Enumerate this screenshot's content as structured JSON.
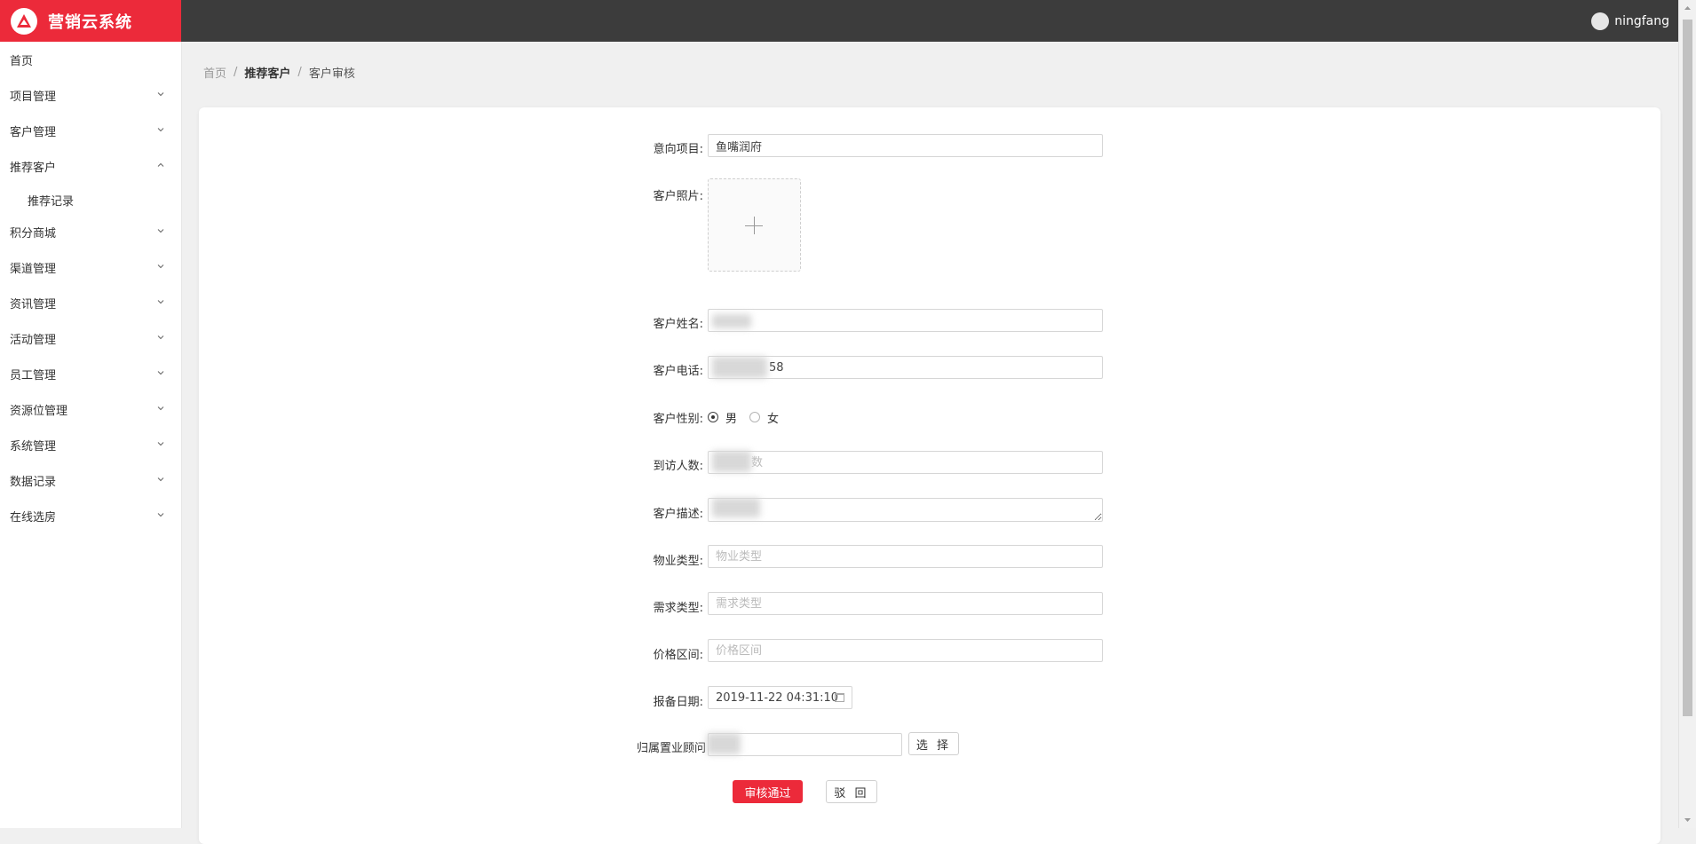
{
  "app": {
    "title": "营销云系统",
    "user": "ningfang"
  },
  "sidebar": {
    "items": [
      {
        "label": "首页",
        "has_arrow": false
      },
      {
        "label": "项目管理",
        "has_arrow": true
      },
      {
        "label": "客户管理",
        "has_arrow": true
      },
      {
        "label": "推荐客户",
        "has_arrow": true,
        "expanded": true,
        "children": [
          {
            "label": "推荐记录"
          }
        ]
      },
      {
        "label": "积分商城",
        "has_arrow": true
      },
      {
        "label": "渠道管理",
        "has_arrow": true
      },
      {
        "label": "资讯管理",
        "has_arrow": true
      },
      {
        "label": "活动管理",
        "has_arrow": true
      },
      {
        "label": "员工管理",
        "has_arrow": true
      },
      {
        "label": "资源位管理",
        "has_arrow": true
      },
      {
        "label": "系统管理",
        "has_arrow": true
      },
      {
        "label": "数据记录",
        "has_arrow": true
      },
      {
        "label": "在线选房",
        "has_arrow": true
      }
    ]
  },
  "breadcrumb": {
    "home": "首页",
    "parent": "推荐客户",
    "current": "客户审核",
    "separator": "/"
  },
  "form": {
    "project": {
      "label": "意向项目:",
      "value": "鱼嘴润府"
    },
    "photo": {
      "label": "客户照片:"
    },
    "name": {
      "label": "客户姓名:",
      "value": ""
    },
    "phone": {
      "label": "客户电话:",
      "value": "58"
    },
    "gender": {
      "label": "客户性别:",
      "options": [
        "男",
        "女"
      ],
      "selected": "男"
    },
    "visitors": {
      "label": "到访人数:",
      "placeholder": "数"
    },
    "description": {
      "label": "客户描述:",
      "value": ""
    },
    "property_type": {
      "label": "物业类型:",
      "placeholder": "物业类型"
    },
    "demand_type": {
      "label": "需求类型:",
      "placeholder": "需求类型"
    },
    "price_range": {
      "label": "价格区间:",
      "placeholder": "价格区间"
    },
    "report_date": {
      "label": "报备日期:",
      "value": "2019-11-22 04:31:10"
    },
    "consultant": {
      "label": "归属置业顾问",
      "value": "",
      "select_label": "选 择"
    },
    "approve_label": "审核通过",
    "reject_label": "驳 回"
  },
  "colors": {
    "brand": "#ec2a3a",
    "header": "#3c3c3c",
    "background": "#f0f0f0"
  }
}
